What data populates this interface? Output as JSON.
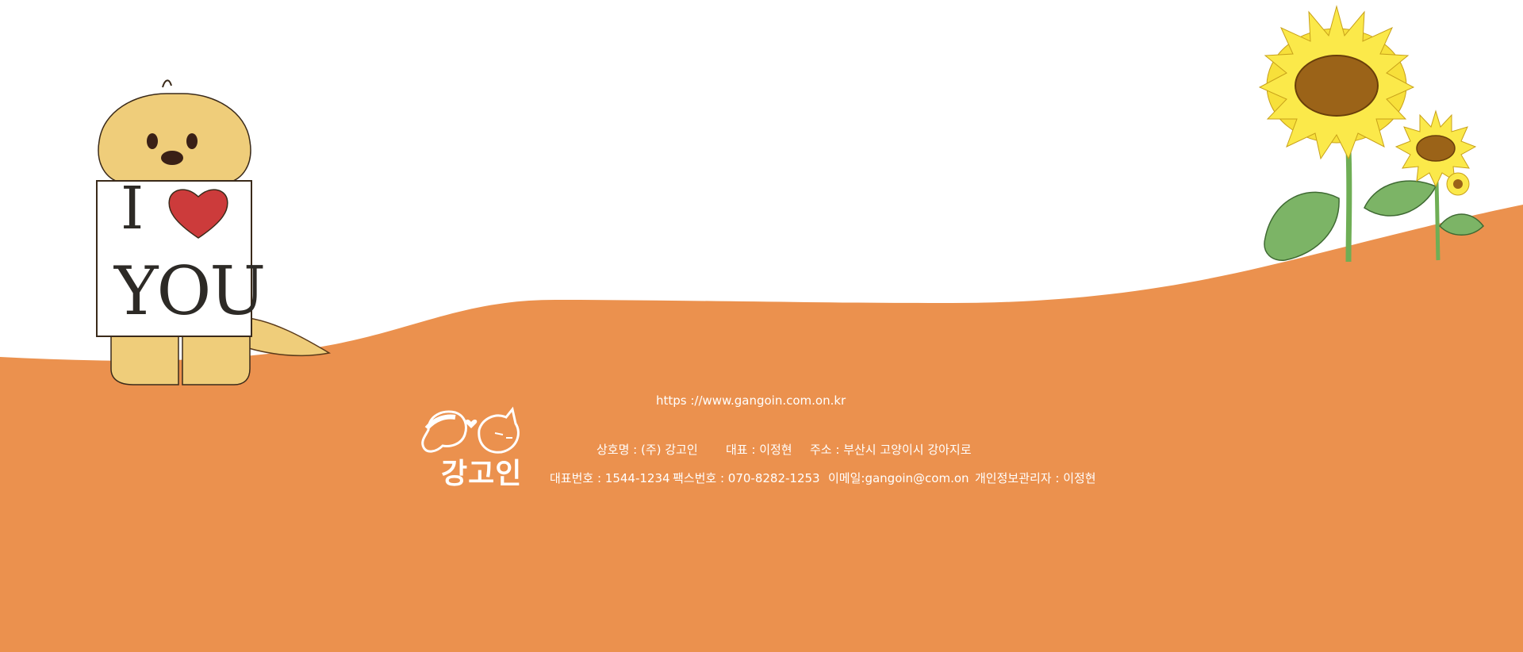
{
  "site": {
    "url": "https ://www.gangoin.com.on.kr",
    "logo_text": "강고인",
    "sign": {
      "line1": "I",
      "line2": "YOU"
    },
    "info_row1": {
      "company": "상호명 : (주) 강고인",
      "ceo": "대표 : 이정현",
      "address": "주소 : 부산시 고양이시 강아지로"
    },
    "info_row2": {
      "phone": "대표번호 : 1544-1234",
      "fax": "팩스번호 : 070-8282-1253",
      "email": "이메일:gangoin@com.on",
      "privacy": "개인정보관리자 : 이정현"
    }
  },
  "colors": {
    "ground": "#eb914e",
    "dog": "#efcd7a",
    "heart": "#cc3b3b",
    "petal": "#f7e03a",
    "seed": "#9b6318",
    "leaf": "#7cb466"
  },
  "icons": [
    "dog-illustration",
    "heart-icon",
    "sunflower-illustration",
    "dog-cat-logo-icon"
  ]
}
